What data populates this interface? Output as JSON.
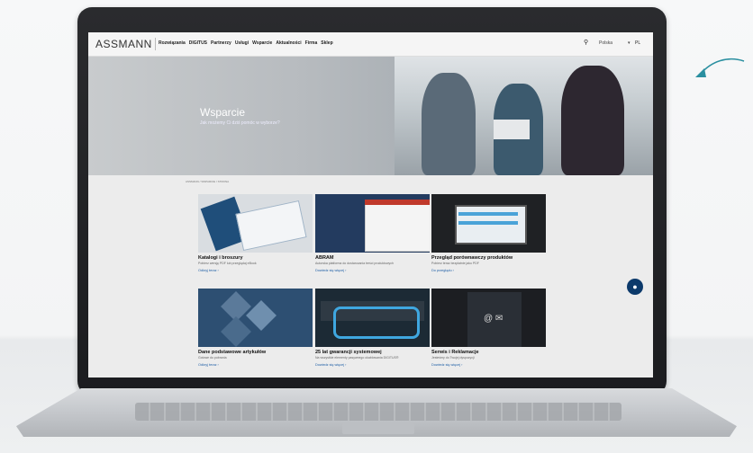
{
  "header": {
    "logo": "ASSMANN",
    "menu": [
      "Rozwiązania",
      "DIGITUS",
      "Partnerzy",
      "Usługi",
      "Wsparcie",
      "Aktualności",
      "Firma",
      "Sklep"
    ],
    "lang_select": "Polska",
    "lang_code": "PL"
  },
  "hero": {
    "title": "Wsparcie",
    "subtitle": "Jak możemy Ci dziś pomóc w wyborze?"
  },
  "breadcrumb": "ASSMANN / WSPARCIE / STRONA",
  "cards": [
    {
      "title": "Katalogi i broszury",
      "desc": "Pobierz wersję PDF lub przeglądaj eBook",
      "link": "Odkryj teraz"
    },
    {
      "title": "ABRAM",
      "desc": "Autorska platforma do dostarczania treści produktowych",
      "link": "Dowiedz się więcej"
    },
    {
      "title": "Przegląd porównawczy produktów",
      "desc": "Pobierz teraz bezpłatnie jako PDF",
      "link": "Do przeglądu"
    },
    {
      "title": "Dane podstawowe artykułów",
      "desc": "Gotowe do pobrania",
      "link": "Odkryj teraz"
    },
    {
      "title": "25 lat gwarancji systemowej",
      "desc": "Na wszystkie elementy pasywnego okablowania DIGITUS®",
      "link": "Dowiedz się więcej"
    },
    {
      "title": "Serwis i Reklamacje",
      "desc": "Jesteśmy do Twojej dyspozycji",
      "link": "Dowiedz się więcej"
    }
  ],
  "colors": {
    "accent": "#1f5fa6",
    "chat": "#0c3a6b",
    "arrow": "#2a8fa0"
  }
}
